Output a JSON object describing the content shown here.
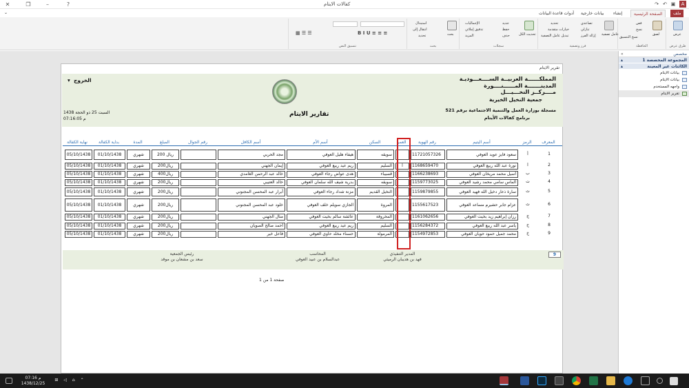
{
  "window": {
    "title": "كفالات الايتام"
  },
  "tabs": [
    "ملف",
    "الصفحة الرئيسية",
    "إنشاء",
    "بيانات خارجية",
    "أدوات قاعدة البيانات"
  ],
  "ribbon": {
    "groups": [
      {
        "label": "طرق عرض",
        "items": [
          "عرض"
        ]
      },
      {
        "label": "الحافظة",
        "items": [
          "لصق",
          "قص",
          "نسخ",
          "نسخ التنسيق"
        ]
      },
      {
        "label": "فرز وتصفية",
        "items": [
          "عامل تصفية",
          "تصاعدي",
          "تنازلي",
          "إزالة الفرز",
          "تحديد",
          "خيارات متقدمة",
          "تبديل عامل التصفية"
        ]
      },
      {
        "label": "سجلات",
        "items": [
          "تحديث الكل",
          "جديد",
          "حفظ",
          "حذف",
          "الإجماليات",
          "تدقيق إملائي",
          "المزيد"
        ]
      },
      {
        "label": "بحث",
        "items": [
          "بحث",
          "استبدال",
          "انتقال إلى",
          "تحديد"
        ]
      },
      {
        "label": "تنسيق النص",
        "items": []
      }
    ]
  },
  "nav": {
    "header": "مخصص",
    "group1": "المجموعة المخصصة 1",
    "group2": "الكائنات غير المعينة",
    "items": [
      "بيانات الايتام",
      "بيانات الايتام",
      "واجهه المستخدم",
      "تقرير الايتام"
    ]
  },
  "report": {
    "tab_title": "تقرير الايتام",
    "exit_label": "الخروج",
    "kingdom_lines": [
      "المملكــــــة العربيــة الســــعـــوديـة",
      "المدينـــــــة المــــــنــــورة",
      "مــــركــز النخـــيـــل"
    ],
    "org_name": "جمعية النخيل الخيرية",
    "registration": "مسجلة بوزارة العمل والتنمية الاجتماعية برقم 521",
    "program": "برنامج كفالات الأيتام",
    "title": "تقارير الايتام",
    "date_line": "السبت 25 ذو الحجة 1438",
    "time_line": "07:16:05 م",
    "columns": [
      "المعرف",
      "الرمز",
      "أسم اليتيم",
      "رقم الهوية",
      "العمر",
      "السكن",
      "أسم الأم",
      "أسم الكافل",
      "رقم الجوال",
      "المبلغ",
      "المدة",
      "بداية الكفالة",
      "نهاية الكفالة"
    ],
    "rows": [
      {
        "id": "1",
        "code": "أ",
        "name": "سعود فايز عويد العوفي",
        "nid": "11721057326",
        "age": "",
        "city": "سويقه",
        "mother": "هيفاء هليل العوفي",
        "sponsor": "مجد الحربي",
        "phone": "",
        "amount": "200 ريال",
        "period": "شهري",
        "start": "01/10/1438",
        "end": "05/10/1438"
      },
      {
        "id": "2",
        "code": "أ",
        "name": "نورة عبد الله ربيع العوفي",
        "nid": "1168659470",
        "age": "أ",
        "city": "السليم",
        "mother": "ريم عيد ربيع العوفي",
        "sponsor": "إيمان الجهني",
        "phone": "",
        "amount": "200ريال",
        "period": "شهري",
        "start": "01/10/1438",
        "end": "05/10/1438"
      },
      {
        "id": "3",
        "code": "ب",
        "name": "أسيل محمد مريخان العوفي",
        "nid": "1166238693",
        "age": "",
        "city": "قسيباء",
        "mother": "هدى عواض رجاء العوفي",
        "sponsor": "خالد عبد الرحمن الغامدي",
        "phone": "",
        "amount": "400ريال",
        "period": "شهري",
        "start": "01/10/1438",
        "end": "05/10/1438"
      },
      {
        "id": "4",
        "code": "ت",
        "name": "ألماس سامي محمد رشيد العوفي",
        "nid": "1159773025",
        "age": "",
        "city": "سويقه",
        "mother": "بدرية شيف الله سلمان العوفي",
        "sponsor": "خالد العتيبي",
        "phone": "",
        "amount": "200ريال",
        "period": "شهري",
        "start": "01/10/1438",
        "end": "05/10/1438"
      },
      {
        "id": "5",
        "code": "ث",
        "name": "سارة ذعار دخيل الله فهيد العوفي",
        "nid": "1159879855",
        "age": "",
        "city": "النخيل القديم",
        "mother": "مزنة شداد رجاء العوفي",
        "sponsor": "أبرار عبد المحسن المجنوني",
        "phone": "",
        "amount": "200ريال",
        "period": "شهري",
        "start": "01/10/1438",
        "end": "05/10/1438"
      },
      {
        "id": "6",
        "code": "ث",
        "name": "عزام جابر حشيرم مساعد العوفي",
        "nid": "1155617523",
        "age": "",
        "city": "المروة",
        "mother": "الجازي سويلم خلف العوفي",
        "sponsor": "خلود عبد المحسن المجنوني",
        "phone": "",
        "amount": "200ريال",
        "period": "شهري",
        "start": "01/10/1438",
        "end": "05/10/1438"
      },
      {
        "id": "7",
        "code": "ج",
        "name": "رزان إبراهيم زيد بخيت العوفي",
        "nid": "1161062656",
        "age": "",
        "city": "المخروقة",
        "mother": "عائشة سالم بخيت العوفي",
        "sponsor": "منال الجهني",
        "phone": "",
        "amount": "200ريال",
        "period": "شهري",
        "start": "01/10/1438",
        "end": "05/10/1438"
      },
      {
        "id": "8",
        "code": "ح",
        "name": "ياسر عبد الله ربيع العوفي",
        "nid": "1156284372",
        "age": "",
        "city": "السليم",
        "mother": "ريم عيد ربيع العوفي",
        "sponsor": "أحمد صالح الصويان",
        "phone": "",
        "amount": "200ريال",
        "period": "شهري",
        "start": "01/10/1438",
        "end": "05/10/1438"
      },
      {
        "id": "9",
        "code": "خ",
        "name": "محمد جميل حمود حويان العوفي",
        "nid": "1154972853",
        "age": "",
        "city": "المرمولة",
        "mother": "حسناء مخلد حاوي العوفي",
        "sponsor": "فاعل خير",
        "phone": "",
        "amount": "200ريال",
        "period": "شهري",
        "start": "01/10/1438",
        "end": "05/10/1438"
      }
    ],
    "count": "9",
    "signatures": [
      {
        "role": "المدير التنفيذي",
        "name": "فهد بن هديبان الرميثي"
      },
      {
        "role": "المحاسب",
        "name": "عبدالسلام بن عبيد العوفي"
      },
      {
        "role": "رئيس الجمعية",
        "name": "سعد بن مشعان بن موقد"
      }
    ],
    "page_label": "صفحة 1 من 1"
  },
  "taskbar": {
    "time": "07:16 م",
    "date": "1438/12/25"
  }
}
